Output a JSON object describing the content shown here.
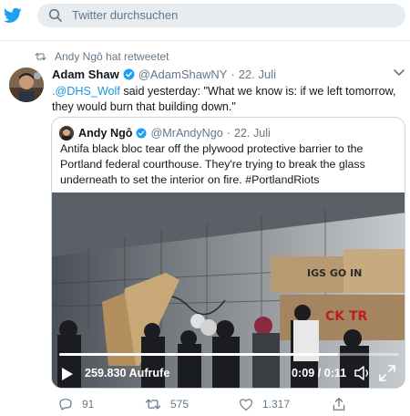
{
  "search": {
    "placeholder": "Twitter durchsuchen"
  },
  "retweet_header": {
    "text": "Andy Ngô hat retweetet"
  },
  "tweet": {
    "author_name": "Adam Shaw",
    "author_handle": "@AdamShawNY",
    "separator": "·",
    "date": "22. Juli",
    "mention": ".@DHS_Wolf",
    "text": " said yesterday: \"What we know is: if we left tomorrow, they would burn that building down.\""
  },
  "quoted_tweet": {
    "author_name": "Andy Ngô",
    "author_handle": "@MrAndyNgo",
    "separator": "·",
    "date": "22. Juli",
    "text": "Antifa black bloc tear off the plywood protective barrier to the Portland federal courthouse. They're trying to break the glass underneath to set the interior on fire. #PortlandRiots"
  },
  "video": {
    "views_label": "259.830 Aufrufe",
    "time_label": "0:09 / 0:11",
    "progress": 0.82
  },
  "actions": {
    "replies": "91",
    "retweets": "575",
    "likes": "1.317"
  },
  "colors": {
    "brand": "#1da1f2",
    "link": "#1b95e0",
    "muted": "#657786",
    "search_bg": "#e6ecf0"
  },
  "icons": [
    "twitter-bird-icon",
    "search-icon",
    "retweet-icon",
    "verified-icon",
    "chevron-down-icon",
    "play-icon",
    "volume-icon",
    "fullscreen-icon",
    "reply-icon",
    "like-icon",
    "share-icon"
  ]
}
